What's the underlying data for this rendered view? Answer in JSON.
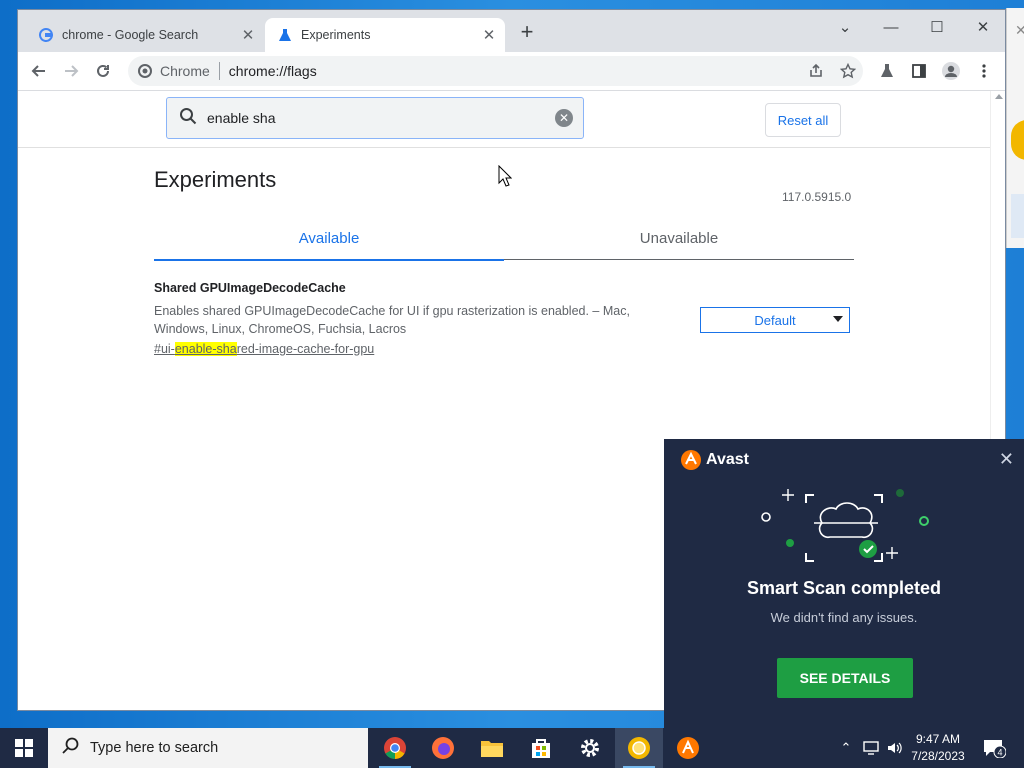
{
  "browser": {
    "tabs": [
      {
        "title": "chrome - Google Search",
        "close": "✕"
      },
      {
        "title": "Experiments",
        "close": "✕"
      }
    ],
    "new_tab": "+",
    "omnibox": {
      "chip": "Chrome",
      "url": "chrome://flags"
    }
  },
  "flags_page": {
    "search_value": "enable sha",
    "reset_label": "Reset all",
    "heading": "Experiments",
    "version": "117.0.5915.0",
    "tab_available": "Available",
    "tab_unavailable": "Unavailable",
    "flag": {
      "name": "Shared GPUImageDecodeCache",
      "description": "Enables shared GPUImageDecodeCache for UI if gpu rasterization is enabled. – Mac, Windows, Linux, ChromeOS, Fuchsia, Lacros",
      "link_prefix": "#ui-",
      "link_match": "enable-sha",
      "link_suffix": "red-image-cache-for-gpu",
      "select_value": "Default"
    }
  },
  "avast": {
    "brand": "Avast",
    "title": "Smart Scan completed",
    "subtitle": "We didn't find any issues.",
    "button": "SEE DETAILS"
  },
  "taskbar": {
    "search_placeholder": "Type here to search",
    "time": "9:47 AM",
    "date": "7/28/2023",
    "notifications": "4"
  },
  "colors": {
    "accent": "#1a73e8",
    "avast_bg": "#1f2a44",
    "avast_button": "#1e9e43",
    "highlight": "#ffff00"
  }
}
